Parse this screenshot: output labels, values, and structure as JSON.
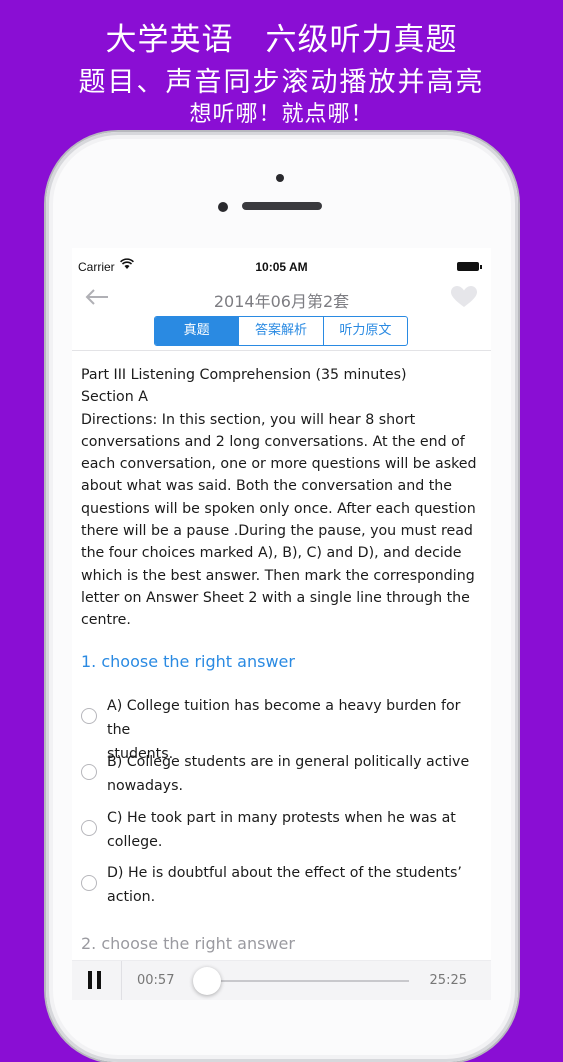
{
  "promo": {
    "line1": "大学英语　六级听力真题",
    "line2": "题目、声音同步滚动播放并高亮",
    "line3": "想听哪！就点哪！"
  },
  "status_bar": {
    "carrier": "Carrier",
    "time": "10:05 AM"
  },
  "nav": {
    "title": "2014年06月第2套"
  },
  "tabs": [
    "真题",
    "答案解析",
    "听力原文"
  ],
  "content": {
    "lines": [
      "Part III Listening Comprehension (35 minutes)",
      "Section A",
      "Directions: In this section, you will hear 8 short",
      "conversations and 2 long conversations. At the end of",
      "each conversation, one or more questions will be asked",
      "about what was said. Both the conversation and the",
      "questions will be spoken only once. After each question",
      "there will be a pause .During the pause, you must read",
      "the four choices marked A), B), C) and D), and decide",
      "which is the best answer. Then mark the corresponding",
      "letter on Answer Sheet 2 with a single line through the",
      "centre."
    ]
  },
  "questions": [
    {
      "title": "1. choose the right answer",
      "options": [
        [
          "A) College tuition has become a heavy burden for the",
          "students."
        ],
        [
          "B) College students are in general politically active",
          "nowadays."
        ],
        [
          "C) He took part in many protests when he was at",
          "college."
        ],
        [
          "D) He is doubtful about the effect of the students’",
          "action."
        ]
      ]
    },
    {
      "title": "2. choose the right answer"
    }
  ],
  "player": {
    "current_time": "00:57",
    "total_time": "25:25",
    "progress": 0.037
  },
  "colors": {
    "background": "#8a0ed4",
    "accent": "#2a8ae2"
  },
  "icons": [
    "wifi-icon",
    "back-arrow-icon",
    "heart-icon",
    "pause-icon"
  ]
}
